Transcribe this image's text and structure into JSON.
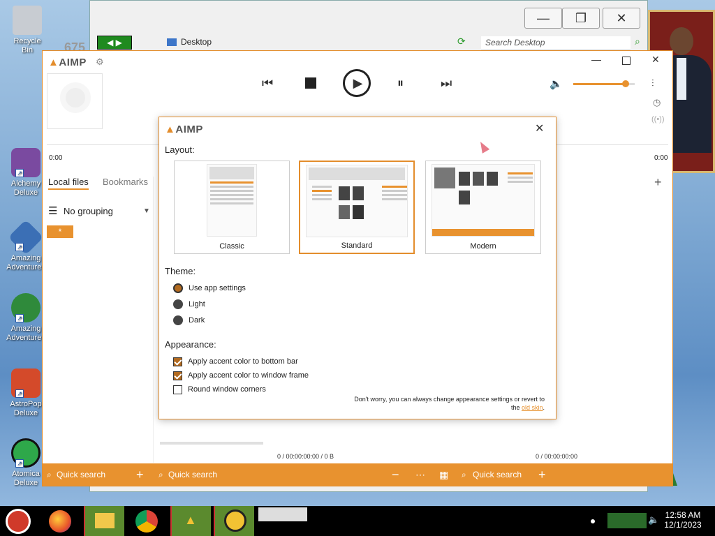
{
  "desktop": {
    "icons": [
      {
        "label": "Recycle Bin",
        "color": "#c8ccd2"
      },
      {
        "label": "Alchemy Deluxe",
        "color": "#7a4aa0"
      },
      {
        "label": "Amazing Adventures",
        "color": "#3b6fb5"
      },
      {
        "label": "Amazing Adventures",
        "color": "#2f8a3b"
      },
      {
        "label": "AstroPop Deluxe",
        "color": "#d44a2a"
      },
      {
        "label": "Atomica Deluxe",
        "color": "#2ea84a"
      }
    ]
  },
  "explorer": {
    "minimize": "—",
    "maximize": "❐",
    "close": "✕",
    "address": "Desktop",
    "search_placeholder": "Search Desktop",
    "nav_label": "675"
  },
  "aimp": {
    "logo": "AIMP",
    "time_start": "0:00",
    "time_end": "0:00",
    "tabs": [
      "Local files",
      "Bookmarks"
    ],
    "grouping": "No grouping",
    "group_tag": "*",
    "status_left": "0 / 00:00:00:00 / 0 B",
    "status_right": "0 / 00:00:00:00",
    "quick_search": [
      "Quick search",
      "Quick search",
      "Quick search"
    ],
    "volume": 0.85,
    "accent": "#e8922f"
  },
  "dialog": {
    "logo": "AIMP",
    "layout_title": "Layout:",
    "layouts": [
      {
        "label": "Classic",
        "selected": false
      },
      {
        "label": "Standard",
        "selected": true
      },
      {
        "label": "Modern",
        "selected": false
      }
    ],
    "theme_title": "Theme:",
    "themes": [
      {
        "label": "Use app settings",
        "selected": true
      },
      {
        "label": "Light",
        "selected": false
      },
      {
        "label": "Dark",
        "selected": false
      }
    ],
    "appearance_title": "Appearance:",
    "options": [
      {
        "label": "Apply accent color to bottom bar",
        "checked": true
      },
      {
        "label": "Apply accent color to window frame",
        "checked": true
      },
      {
        "label": "Round window corners",
        "checked": false
      }
    ],
    "footer_text": "Don't worry, you can always change appearance settings or revert to",
    "footer_the": "the",
    "footer_link": "old skin",
    "footer_end": "."
  },
  "clock": {
    "time": "12:58 AM",
    "date": "12/1/2023"
  }
}
